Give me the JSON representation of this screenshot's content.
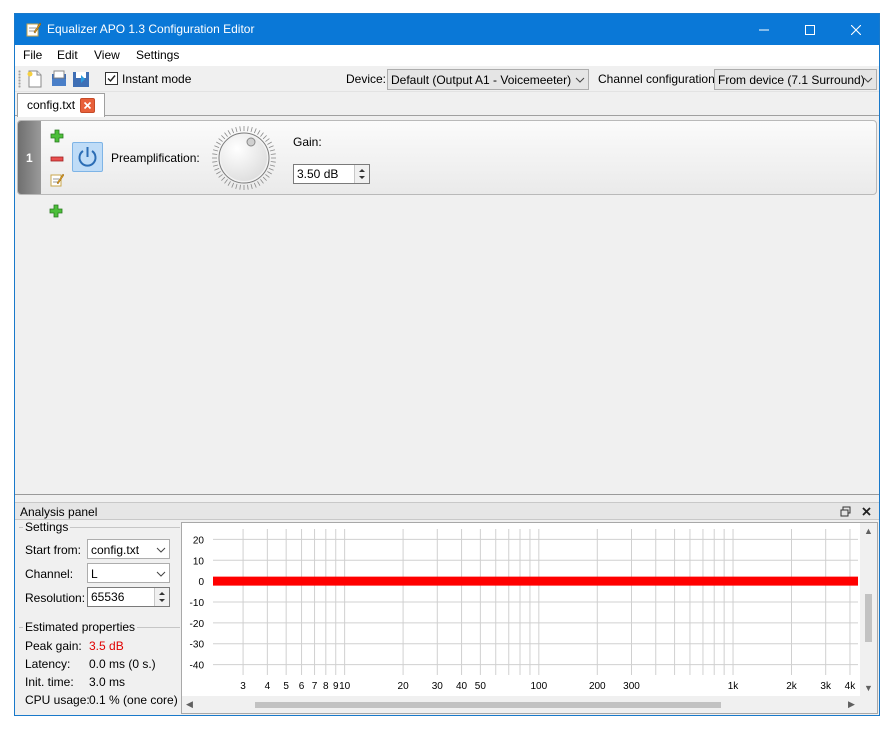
{
  "window": {
    "title": "Equalizer APO 1.3 Configuration Editor",
    "accent_color": "#0a78d7",
    "controls": [
      "minimize-icon",
      "maximize-icon",
      "close-icon"
    ]
  },
  "menu": {
    "file": "File",
    "edit": "Edit",
    "view": "View",
    "settings": "Settings"
  },
  "toolbar": {
    "new_icon": "new-file-icon",
    "open_icon": "open-folder-icon",
    "save_icon": "save-icon",
    "instant_mode_label": "Instant mode",
    "instant_mode_checked": true,
    "device_label": "Device:",
    "device_value": "Default (Output A1 - Voicemeeter)",
    "channel_config_label": "Channel configuration:",
    "channel_config_value": "From device (7.1 Surround)"
  },
  "tabs": [
    {
      "label": "config.txt",
      "active": true
    }
  ],
  "filters": [
    {
      "index": "1",
      "enabled": true,
      "label": "Preamplification:",
      "gain_label": "Gain:",
      "gain_value": "3.50 dB"
    }
  ],
  "analysis": {
    "title": "Analysis panel",
    "settings_title": "Settings",
    "start_from_label": "Start from:",
    "start_from_value": "config.txt",
    "channel_label": "Channel:",
    "channel_value": "L",
    "resolution_label": "Resolution:",
    "resolution_value": "65536",
    "props_title": "Estimated properties",
    "peak_gain_label": "Peak gain:",
    "peak_gain_value": "3.5 dB",
    "peak_gain_color": "#e00000",
    "latency_label": "Latency:",
    "latency_value": "0.0 ms (0 s.)",
    "init_time_label": "Init. time:",
    "init_time_value": "3.0 ms",
    "cpu_label": "CPU usage:",
    "cpu_value": "0.1 % (one core)"
  },
  "chart_data": {
    "type": "line",
    "title": "",
    "xlabel": "",
    "ylabel": "",
    "x_scale": "log",
    "ylim": [
      -45,
      25
    ],
    "y_ticks": [
      20,
      10,
      0,
      -10,
      -20,
      -30,
      -40
    ],
    "x_ticks": [
      {
        "v": 3,
        "l": "3"
      },
      {
        "v": 4,
        "l": "4"
      },
      {
        "v": 5,
        "l": "5"
      },
      {
        "v": 6,
        "l": "6"
      },
      {
        "v": 7,
        "l": "7"
      },
      {
        "v": 8,
        "l": "8"
      },
      {
        "v": 9,
        "l": "9"
      },
      {
        "v": 10,
        "l": "10"
      },
      {
        "v": 20,
        "l": "20"
      },
      {
        "v": 30,
        "l": "30"
      },
      {
        "v": 40,
        "l": "40"
      },
      {
        "v": 50,
        "l": "50"
      },
      {
        "v": 100,
        "l": "100"
      },
      {
        "v": 200,
        "l": "200"
      },
      {
        "v": 300,
        "l": "300"
      },
      {
        "v": 1000,
        "l": "1k"
      },
      {
        "v": 2000,
        "l": "2k"
      },
      {
        "v": 3000,
        "l": "3k"
      },
      {
        "v": 4000,
        "l": "4k"
      }
    ],
    "grid": true,
    "series": [
      {
        "color": "#ff0000",
        "x": [
          2.1,
          4400
        ],
        "y": [
          0,
          0
        ]
      }
    ]
  }
}
